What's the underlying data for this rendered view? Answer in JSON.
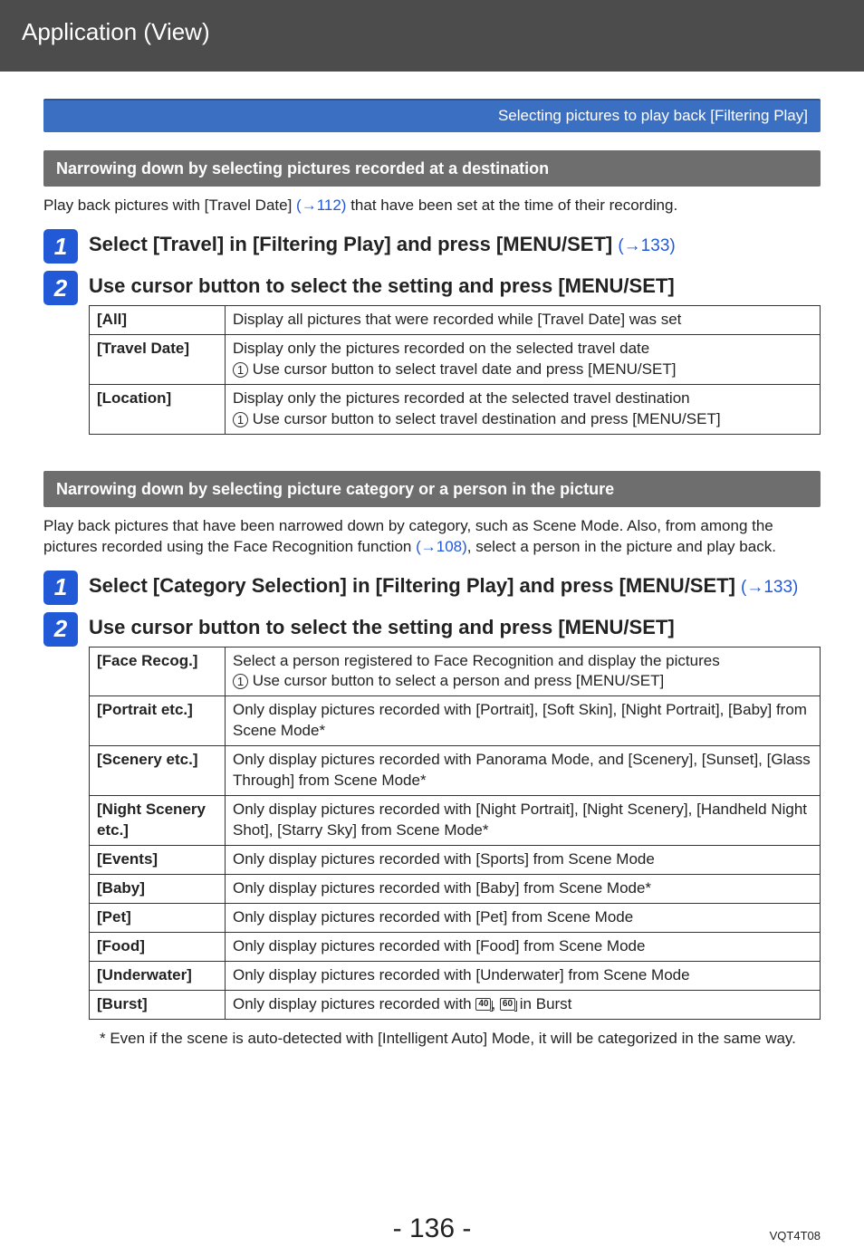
{
  "header": {
    "title": "Application (View)"
  },
  "subhead": "Selecting pictures to play back  [Filtering Play]",
  "sectionA": {
    "title": "Narrowing down by selecting pictures recorded at a destination",
    "intro_a": "Play back pictures with [Travel Date] ",
    "intro_link": "(→112)",
    "intro_b": " that have been set at the time of their recording.",
    "step1_badge": "1",
    "step1_text": "Select [Travel] in [Filtering Play] and press [MENU/SET] ",
    "step1_link": "(→133)",
    "step2_badge": "2",
    "step2_text": "Use cursor button to select the setting and press [MENU/SET]",
    "table": {
      "rows": [
        {
          "key": "[All]",
          "desc": "Display all pictures that were recorded while [Travel Date] was set"
        },
        {
          "key": "[Travel Date]",
          "desc_a": "Display only the pictures recorded on the selected travel date",
          "desc_b": " Use cursor button to select travel date and press [MENU/SET]"
        },
        {
          "key": "[Location]",
          "desc_a": "Display only the pictures recorded at the selected travel destination",
          "desc_b": " Use cursor button to select travel destination and press [MENU/SET]"
        }
      ]
    }
  },
  "sectionB": {
    "title": "Narrowing down by selecting picture category or a person in the picture",
    "intro_a": "Play back pictures that have been narrowed down by category, such as Scene Mode. Also, from among the pictures recorded using the Face Recognition function ",
    "intro_link": "(→108)",
    "intro_b": ", select a person in the picture and play back.",
    "step1_badge": "1",
    "step1_text_a": "Select [Category Selection] in [Filtering Play] and press [MENU/SET] ",
    "step1_link": "(→133)",
    "step2_badge": "2",
    "step2_text": "Use cursor button to select the setting and press [MENU/SET]",
    "table": {
      "rows": [
        {
          "key": "[Face Recog.]",
          "desc_a": "Select a person registered to Face Recognition and display the pictures",
          "desc_b": " Use cursor button to select a person and press [MENU/SET]"
        },
        {
          "key": "[Portrait etc.]",
          "desc": "Only display pictures recorded with [Portrait], [Soft Skin], [Night Portrait], [Baby] from Scene Mode*"
        },
        {
          "key": "[Scenery etc.]",
          "desc": "Only display pictures recorded with Panorama Mode, and [Scenery], [Sunset], [Glass Through] from Scene Mode*"
        },
        {
          "key": "[Night Scenery etc.]",
          "desc": "Only display pictures recorded with [Night Portrait], [Night Scenery], [Handheld Night Shot], [Starry Sky] from Scene Mode*"
        },
        {
          "key": "[Events]",
          "desc": "Only display pictures recorded with [Sports] from Scene Mode"
        },
        {
          "key": "[Baby]",
          "desc": "Only display pictures recorded with [Baby] from Scene Mode*"
        },
        {
          "key": "[Pet]",
          "desc": "Only display pictures recorded with [Pet] from Scene Mode"
        },
        {
          "key": "[Food]",
          "desc": "Only display pictures recorded with [Food] from Scene Mode"
        },
        {
          "key": "[Underwater]",
          "desc": "Only display pictures recorded with [Underwater] from Scene Mode"
        },
        {
          "key": "[Burst]",
          "desc_a": "Only display pictures recorded with ",
          "desc_b": " in Burst",
          "icon1": "40",
          "icon2": "60"
        }
      ]
    },
    "footnote": "* Even if the scene is auto-detected with [Intelligent Auto] Mode, it will be categorized in the same way."
  },
  "footer": {
    "pageno": "- 136 -",
    "doccode": "VQT4T08"
  },
  "circ1": "1"
}
